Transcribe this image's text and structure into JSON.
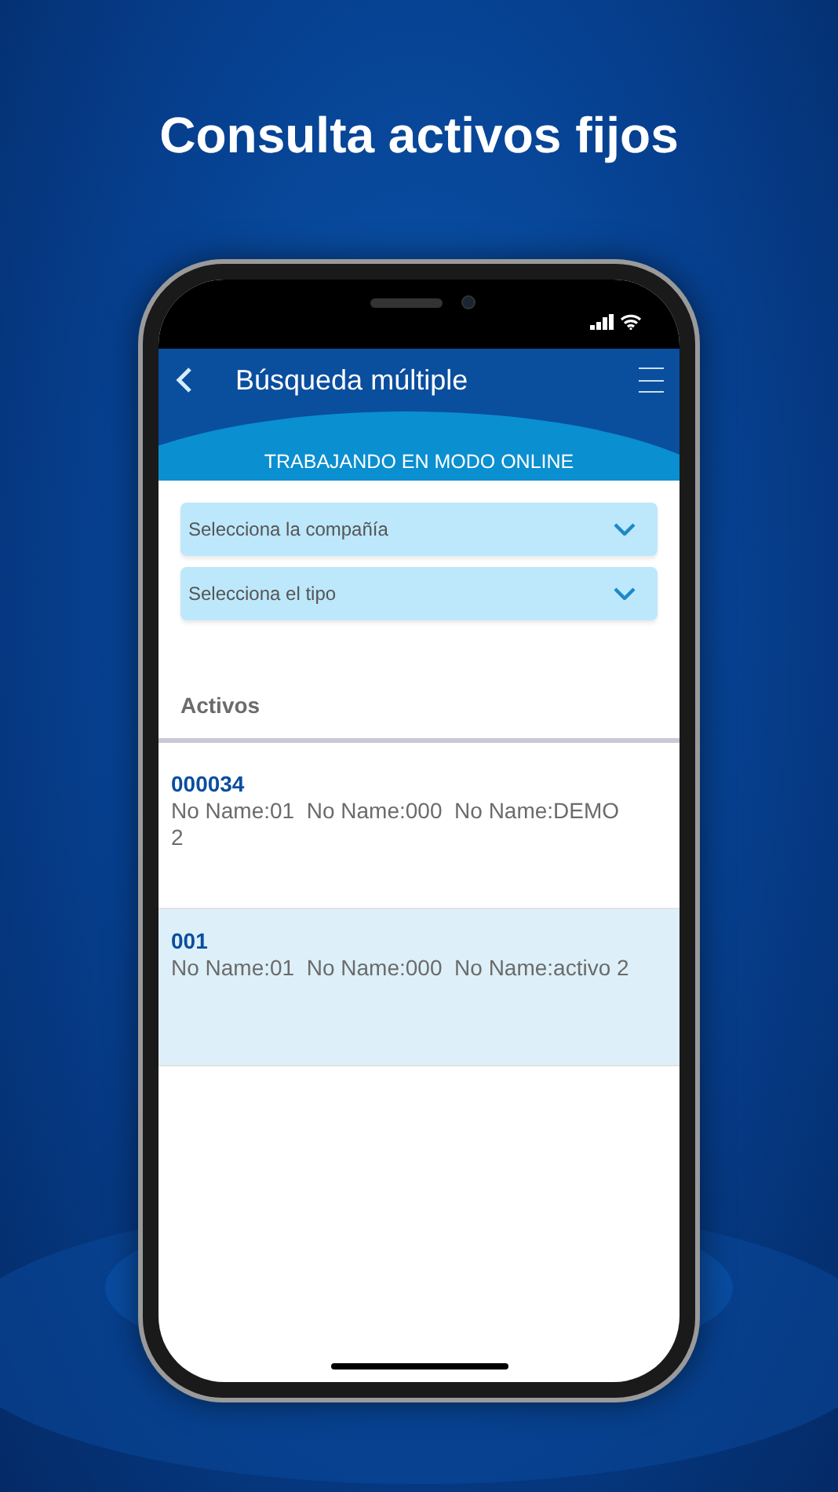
{
  "headline": "Consulta activos fijos",
  "screen": {
    "title": "Búsqueda múltiple",
    "mode_banner": "TRABAJANDO EN MODO ONLINE",
    "dropdowns": [
      {
        "placeholder": "Selecciona la compañía"
      },
      {
        "placeholder": "Selecciona el tipo"
      }
    ],
    "section_title": "Activos",
    "assets": [
      {
        "code": "000034",
        "details": "No Name:01  No Name:000  No Name:DEMO 2",
        "selected": false
      },
      {
        "code": "001",
        "details": "No Name:01  No Name:000  No Name:activo 2",
        "selected": true
      }
    ]
  }
}
